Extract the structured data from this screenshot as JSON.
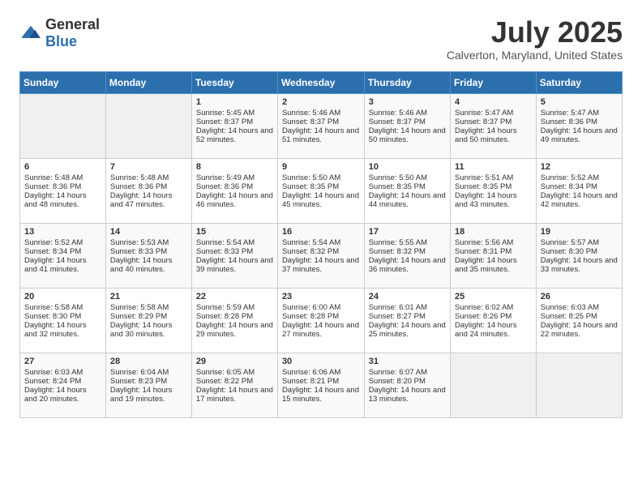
{
  "logo": {
    "text_general": "General",
    "text_blue": "Blue"
  },
  "title": {
    "month_year": "July 2025",
    "location": "Calverton, Maryland, United States"
  },
  "calendar": {
    "headers": [
      "Sunday",
      "Monday",
      "Tuesday",
      "Wednesday",
      "Thursday",
      "Friday",
      "Saturday"
    ],
    "weeks": [
      [
        {
          "day": "",
          "sunrise": "",
          "sunset": "",
          "daylight": ""
        },
        {
          "day": "",
          "sunrise": "",
          "sunset": "",
          "daylight": ""
        },
        {
          "day": "1",
          "sunrise": "Sunrise: 5:45 AM",
          "sunset": "Sunset: 8:37 PM",
          "daylight": "Daylight: 14 hours and 52 minutes."
        },
        {
          "day": "2",
          "sunrise": "Sunrise: 5:46 AM",
          "sunset": "Sunset: 8:37 PM",
          "daylight": "Daylight: 14 hours and 51 minutes."
        },
        {
          "day": "3",
          "sunrise": "Sunrise: 5:46 AM",
          "sunset": "Sunset: 8:37 PM",
          "daylight": "Daylight: 14 hours and 50 minutes."
        },
        {
          "day": "4",
          "sunrise": "Sunrise: 5:47 AM",
          "sunset": "Sunset: 8:37 PM",
          "daylight": "Daylight: 14 hours and 50 minutes."
        },
        {
          "day": "5",
          "sunrise": "Sunrise: 5:47 AM",
          "sunset": "Sunset: 8:36 PM",
          "daylight": "Daylight: 14 hours and 49 minutes."
        }
      ],
      [
        {
          "day": "6",
          "sunrise": "Sunrise: 5:48 AM",
          "sunset": "Sunset: 8:36 PM",
          "daylight": "Daylight: 14 hours and 48 minutes."
        },
        {
          "day": "7",
          "sunrise": "Sunrise: 5:48 AM",
          "sunset": "Sunset: 8:36 PM",
          "daylight": "Daylight: 14 hours and 47 minutes."
        },
        {
          "day": "8",
          "sunrise": "Sunrise: 5:49 AM",
          "sunset": "Sunset: 8:36 PM",
          "daylight": "Daylight: 14 hours and 46 minutes."
        },
        {
          "day": "9",
          "sunrise": "Sunrise: 5:50 AM",
          "sunset": "Sunset: 8:35 PM",
          "daylight": "Daylight: 14 hours and 45 minutes."
        },
        {
          "day": "10",
          "sunrise": "Sunrise: 5:50 AM",
          "sunset": "Sunset: 8:35 PM",
          "daylight": "Daylight: 14 hours and 44 minutes."
        },
        {
          "day": "11",
          "sunrise": "Sunrise: 5:51 AM",
          "sunset": "Sunset: 8:35 PM",
          "daylight": "Daylight: 14 hours and 43 minutes."
        },
        {
          "day": "12",
          "sunrise": "Sunrise: 5:52 AM",
          "sunset": "Sunset: 8:34 PM",
          "daylight": "Daylight: 14 hours and 42 minutes."
        }
      ],
      [
        {
          "day": "13",
          "sunrise": "Sunrise: 5:52 AM",
          "sunset": "Sunset: 8:34 PM",
          "daylight": "Daylight: 14 hours and 41 minutes."
        },
        {
          "day": "14",
          "sunrise": "Sunrise: 5:53 AM",
          "sunset": "Sunset: 8:33 PM",
          "daylight": "Daylight: 14 hours and 40 minutes."
        },
        {
          "day": "15",
          "sunrise": "Sunrise: 5:54 AM",
          "sunset": "Sunset: 8:33 PM",
          "daylight": "Daylight: 14 hours and 39 minutes."
        },
        {
          "day": "16",
          "sunrise": "Sunrise: 5:54 AM",
          "sunset": "Sunset: 8:32 PM",
          "daylight": "Daylight: 14 hours and 37 minutes."
        },
        {
          "day": "17",
          "sunrise": "Sunrise: 5:55 AM",
          "sunset": "Sunset: 8:32 PM",
          "daylight": "Daylight: 14 hours and 36 minutes."
        },
        {
          "day": "18",
          "sunrise": "Sunrise: 5:56 AM",
          "sunset": "Sunset: 8:31 PM",
          "daylight": "Daylight: 14 hours and 35 minutes."
        },
        {
          "day": "19",
          "sunrise": "Sunrise: 5:57 AM",
          "sunset": "Sunset: 8:30 PM",
          "daylight": "Daylight: 14 hours and 33 minutes."
        }
      ],
      [
        {
          "day": "20",
          "sunrise": "Sunrise: 5:58 AM",
          "sunset": "Sunset: 8:30 PM",
          "daylight": "Daylight: 14 hours and 32 minutes."
        },
        {
          "day": "21",
          "sunrise": "Sunrise: 5:58 AM",
          "sunset": "Sunset: 8:29 PM",
          "daylight": "Daylight: 14 hours and 30 minutes."
        },
        {
          "day": "22",
          "sunrise": "Sunrise: 5:59 AM",
          "sunset": "Sunset: 8:28 PM",
          "daylight": "Daylight: 14 hours and 29 minutes."
        },
        {
          "day": "23",
          "sunrise": "Sunrise: 6:00 AM",
          "sunset": "Sunset: 8:28 PM",
          "daylight": "Daylight: 14 hours and 27 minutes."
        },
        {
          "day": "24",
          "sunrise": "Sunrise: 6:01 AM",
          "sunset": "Sunset: 8:27 PM",
          "daylight": "Daylight: 14 hours and 25 minutes."
        },
        {
          "day": "25",
          "sunrise": "Sunrise: 6:02 AM",
          "sunset": "Sunset: 8:26 PM",
          "daylight": "Daylight: 14 hours and 24 minutes."
        },
        {
          "day": "26",
          "sunrise": "Sunrise: 6:03 AM",
          "sunset": "Sunset: 8:25 PM",
          "daylight": "Daylight: 14 hours and 22 minutes."
        }
      ],
      [
        {
          "day": "27",
          "sunrise": "Sunrise: 6:03 AM",
          "sunset": "Sunset: 8:24 PM",
          "daylight": "Daylight: 14 hours and 20 minutes."
        },
        {
          "day": "28",
          "sunrise": "Sunrise: 6:04 AM",
          "sunset": "Sunset: 8:23 PM",
          "daylight": "Daylight: 14 hours and 19 minutes."
        },
        {
          "day": "29",
          "sunrise": "Sunrise: 6:05 AM",
          "sunset": "Sunset: 8:22 PM",
          "daylight": "Daylight: 14 hours and 17 minutes."
        },
        {
          "day": "30",
          "sunrise": "Sunrise: 6:06 AM",
          "sunset": "Sunset: 8:21 PM",
          "daylight": "Daylight: 14 hours and 15 minutes."
        },
        {
          "day": "31",
          "sunrise": "Sunrise: 6:07 AM",
          "sunset": "Sunset: 8:20 PM",
          "daylight": "Daylight: 14 hours and 13 minutes."
        },
        {
          "day": "",
          "sunrise": "",
          "sunset": "",
          "daylight": ""
        },
        {
          "day": "",
          "sunrise": "",
          "sunset": "",
          "daylight": ""
        }
      ]
    ]
  }
}
